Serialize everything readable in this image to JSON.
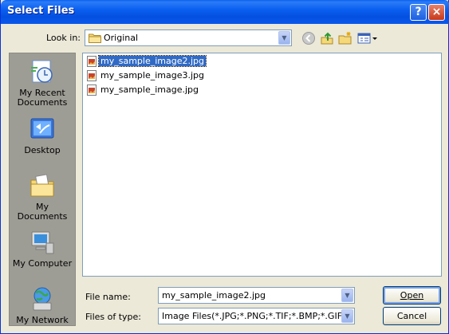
{
  "window": {
    "title": "Select Files",
    "help_icon": "?",
    "close_icon": "×"
  },
  "toolbar": {
    "look_in_label": "Look in:",
    "look_in_value": "Original",
    "icons": [
      "back-icon",
      "up-folder-icon",
      "new-folder-icon",
      "view-menu-icon"
    ]
  },
  "places": [
    {
      "label": "My Recent Documents",
      "icon": "recent-documents-icon"
    },
    {
      "label": "Desktop",
      "icon": "desktop-icon"
    },
    {
      "label": "My Documents",
      "icon": "my-documents-icon"
    },
    {
      "label": "My Computer",
      "icon": "my-computer-icon"
    },
    {
      "label": "My Network",
      "icon": "my-network-icon"
    }
  ],
  "files": [
    {
      "name": "my_sample_image2.jpg",
      "selected": true
    },
    {
      "name": "my_sample_image3.jpg",
      "selected": false
    },
    {
      "name": "my_sample_image.jpg",
      "selected": false
    }
  ],
  "form": {
    "file_name_label": "File name:",
    "file_name_value": "my_sample_image2.jpg",
    "file_type_label": "Files of type:",
    "file_type_value": "Image Files(*.JPG;*.PNG;*.TIF;*.BMP;*.GIF)"
  },
  "buttons": {
    "open": "Open",
    "cancel": "Cancel"
  },
  "colors": {
    "titlebar": "#0a5ff0",
    "selection": "#316ac5",
    "face": "#ece9d8"
  }
}
